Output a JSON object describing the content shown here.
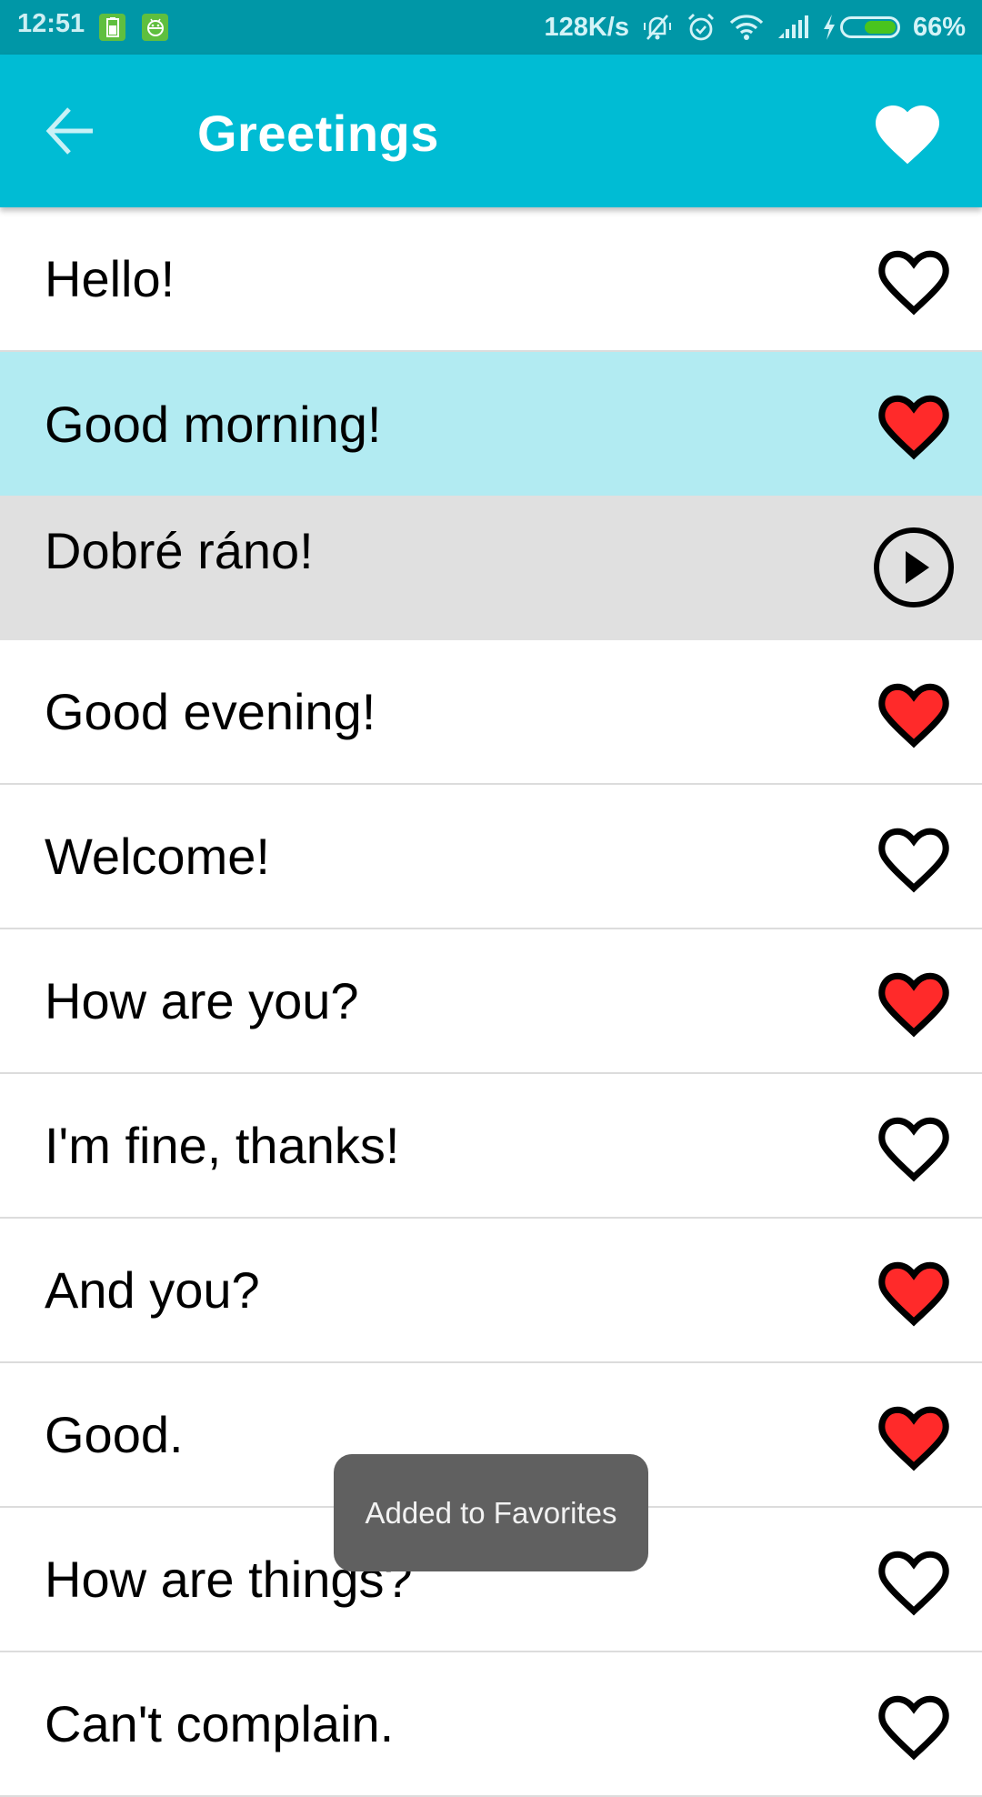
{
  "status_bar": {
    "time": "12:51",
    "notification_icons": [
      "battery-saver-icon",
      "android-debug-icon"
    ],
    "network_speed": "128K/s",
    "system_icons": [
      "silent-bell-icon",
      "alarm-icon",
      "wifi-icon",
      "signal-icon",
      "charging-icon"
    ],
    "battery_percent_label": "66%",
    "battery_level": 0.66
  },
  "app_bar": {
    "back_icon": "arrow-back-icon",
    "title": "Greetings",
    "favorites_icon": "heart-filled-icon"
  },
  "colors": {
    "status_bar": "#0097a7",
    "app_bar": "#00bcd4",
    "selected_row": "#b2ebf2",
    "translation_row": "#e0e0e0",
    "favorite_red": "#ff2a2a",
    "toast_bg": "#606060"
  },
  "phrases": [
    {
      "text": "Hello!",
      "favorite": false
    },
    {
      "text": "Good morning!",
      "favorite": true,
      "selected": true
    },
    {
      "text": "Dobré ráno!",
      "translation": true,
      "action_icon": "play-circle-icon"
    },
    {
      "text": "Good evening!",
      "favorite": true
    },
    {
      "text": "Welcome!",
      "favorite": false
    },
    {
      "text": "How are you?",
      "favorite": true
    },
    {
      "text": "I'm fine, thanks!",
      "favorite": false
    },
    {
      "text": "And you?",
      "favorite": true
    },
    {
      "text": "Good.",
      "favorite": true
    },
    {
      "text": "How are things?",
      "favorite": false
    },
    {
      "text": "Can't complain.",
      "favorite": false
    }
  ],
  "toast": {
    "message": "Added to Favorites"
  }
}
